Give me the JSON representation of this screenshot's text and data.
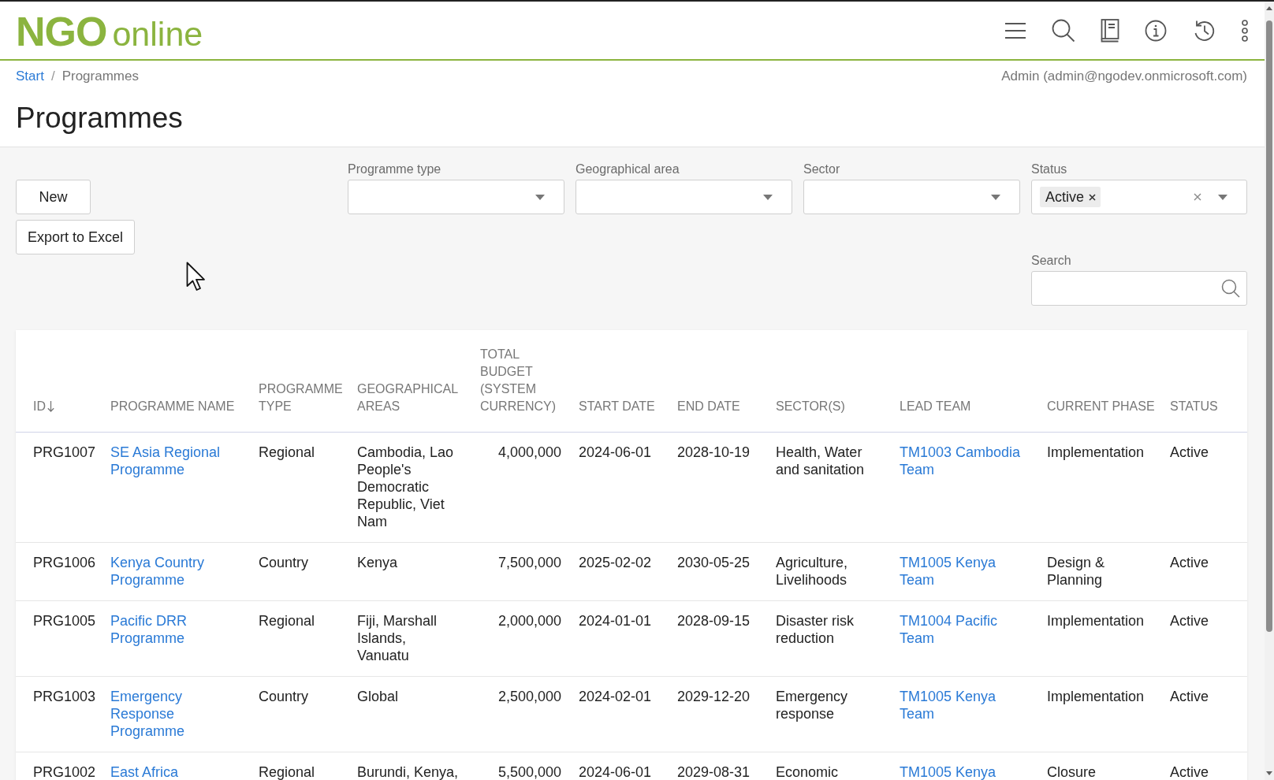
{
  "header": {
    "logo": {
      "strong": "NGO",
      "light": "online"
    },
    "toolbar": [
      {
        "kind": "menu"
      },
      {
        "kind": "search"
      },
      {
        "kind": "book"
      },
      {
        "kind": "info"
      },
      {
        "kind": "history"
      },
      {
        "kind": "more"
      }
    ]
  },
  "breadcrumb": {
    "separator": "/",
    "items": [
      {
        "label": "Start",
        "current": false
      },
      {
        "label": "Programmes",
        "current": true
      }
    ]
  },
  "user": "Admin (admin@ngodev.onmicrosoft.com)",
  "title": "Programmes",
  "actions": [
    {
      "label": "New"
    },
    {
      "label": "Export to Excel"
    }
  ],
  "filters": [
    {
      "label": "Programme type",
      "clearable": false
    },
    {
      "label": "Geographical area",
      "clearable": false
    },
    {
      "label": "Sector",
      "clearable": false
    },
    {
      "label": "Status",
      "chips": [
        "Active"
      ],
      "clearable": true
    }
  ],
  "search": {
    "label": "Search"
  },
  "table": {
    "columns": [
      {
        "label": "ID",
        "kind": "text",
        "sorted": true,
        "descending": true
      },
      {
        "label": "PROGRAMME NAME",
        "kind": "link",
        "sorted": false
      },
      {
        "label": "PROGRAMME TYPE",
        "kind": "text",
        "sorted": false
      },
      {
        "label": "GEOGRAPHICAL AREAS",
        "kind": "text",
        "sorted": false
      },
      {
        "label": "TOTAL BUDGET (SYSTEM CURRENCY)",
        "kind": "number",
        "sorted": false
      },
      {
        "label": "START DATE",
        "kind": "text",
        "sorted": false
      },
      {
        "label": "END DATE",
        "kind": "text",
        "sorted": false
      },
      {
        "label": "SECTOR(S)",
        "kind": "text",
        "sorted": false
      },
      {
        "label": "LEAD TEAM",
        "kind": "link",
        "sorted": false
      },
      {
        "label": "CURRENT PHASE",
        "kind": "text",
        "sorted": false
      },
      {
        "label": "STATUS",
        "kind": "text",
        "sorted": false
      }
    ],
    "rows": [
      [
        "PRG1007",
        "SE Asia Regional Programme",
        "Regional",
        "Cambodia, Lao People's Democratic Republic, Viet Nam",
        "4,000,000",
        "2024-06-01",
        "2028-10-19",
        "Health, Water and sanitation",
        "TM1003 Cambodia Team",
        "Implementation",
        "Active"
      ],
      [
        "PRG1006",
        "Kenya Country Programme",
        "Country",
        "Kenya",
        "7,500,000",
        "2025-02-02",
        "2030-05-25",
        "Agriculture, Livelihoods",
        "TM1005 Kenya Team",
        "Design & Planning",
        "Active"
      ],
      [
        "PRG1005",
        "Pacific DRR Programme",
        "Regional",
        "Fiji, Marshall Islands, Vanuatu",
        "2,000,000",
        "2024-01-01",
        "2028-09-15",
        "Disaster risk reduction",
        "TM1004 Pacific Team",
        "Implementation",
        "Active"
      ],
      [
        "PRG1003",
        "Emergency Response Programme",
        "Country",
        "Global",
        "2,500,000",
        "2024-02-01",
        "2029-12-20",
        "Emergency response",
        "TM1005 Kenya Team",
        "Implementation",
        "Active"
      ],
      [
        "PRG1002",
        "East Africa",
        "Regional",
        "Burundi, Kenya,",
        "5,500,000",
        "2024-06-01",
        "2029-08-31",
        "Economic",
        "TM1005 Kenya",
        "Closure",
        "Active"
      ]
    ]
  }
}
